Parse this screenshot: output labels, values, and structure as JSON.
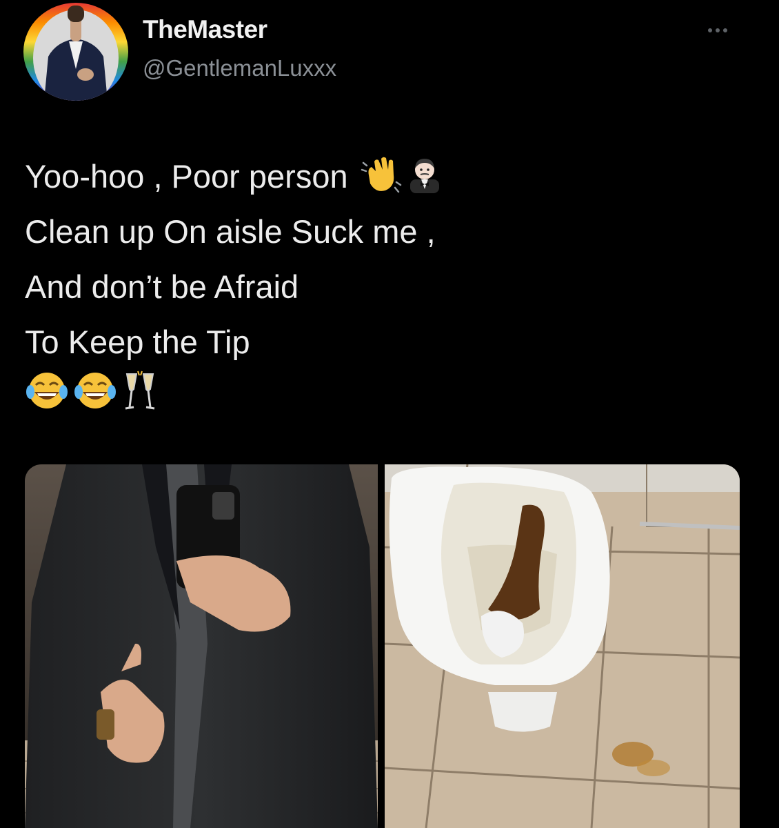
{
  "author": {
    "display_name": "TheMaster",
    "handle": "@GentlemanLuxxx",
    "avatar_icon": "profile-photo-icon"
  },
  "menu": {
    "more_icon": "more-options-icon",
    "more_label": "..."
  },
  "tweet": {
    "lines": [
      "Yoo-hoo  , Poor person",
      "Clean up On aisle Suck me ,",
      "And don’t be Afraid",
      "To Keep the Tip"
    ],
    "line1_emojis": [
      "waving-hand-icon",
      "man-in-tuxedo-icon"
    ],
    "emoji_line": [
      "face-with-tears-of-joy-icon",
      "face-with-tears-of-joy-icon",
      "clinking-glasses-icon"
    ]
  },
  "media": {
    "photos": [
      "mirror-selfie-photo",
      "toilet-photo"
    ]
  },
  "colors": {
    "background": "#000000",
    "text": "#e7e9ea",
    "secondary_text": "#8b9096"
  }
}
